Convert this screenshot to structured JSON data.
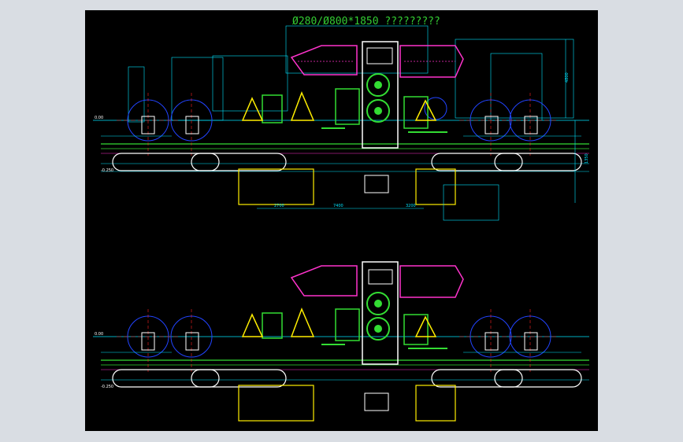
{
  "viewport": {
    "background": "#000000",
    "frame_color": "#d9dde3"
  },
  "drawing": {
    "title": "Ø280/Ø800*1850 ?????????",
    "title_color": "#33cc33",
    "colors": {
      "cyan": "#00e5ff",
      "magenta": "#ff33cc",
      "green": "#33dd33",
      "yellow": "#ffee00",
      "blue": "#2244ff",
      "red": "#ff2222",
      "white": "#ffffff"
    },
    "top_view": {
      "dims_bottom": [
        "2700",
        "7400",
        "3200"
      ],
      "dim_right_vertical": "1350",
      "dim_right_top": "4800",
      "level_label_left_top": "0.00",
      "level_label_left_bottom": "-0.250"
    },
    "bottom_view": {
      "level_label_left_top": "0.00",
      "level_label_left_bottom": "-0.250"
    }
  }
}
